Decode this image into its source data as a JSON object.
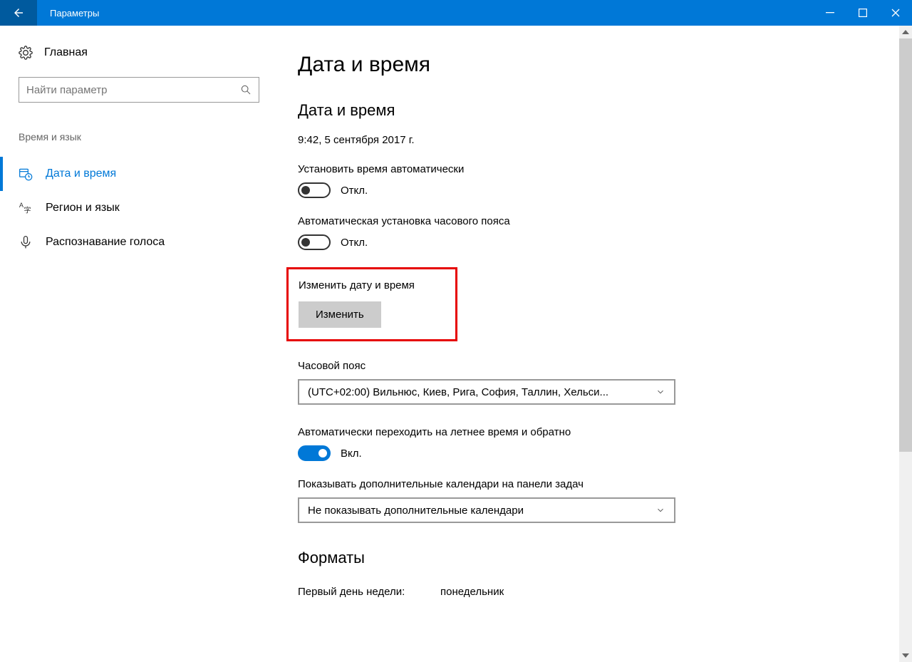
{
  "titlebar": {
    "title": "Параметры"
  },
  "sidebar": {
    "home": "Главная",
    "search_placeholder": "Найти параметр",
    "section": "Время и язык",
    "items": [
      {
        "label": "Дата и время"
      },
      {
        "label": "Регион и язык"
      },
      {
        "label": "Распознавание голоса"
      }
    ]
  },
  "page": {
    "title": "Дата и время",
    "datetime_section": "Дата и время",
    "current_datetime": "9:42, 5 сентября 2017 г.",
    "auto_time_label": "Установить время автоматически",
    "auto_time_state": "Откл.",
    "auto_tz_label": "Автоматическая установка часового пояса",
    "auto_tz_state": "Откл.",
    "change_dt_label": "Изменить дату и время",
    "change_button": "Изменить",
    "timezone_label": "Часовой пояс",
    "timezone_value": "(UTC+02:00) Вильнюс, Киев, Рига, София, Таллин, Хельси...",
    "dst_label": "Автоматически переходить на летнее время и обратно",
    "dst_state": "Вкл.",
    "calendars_label": "Показывать дополнительные календари на панели задач",
    "calendars_value": "Не показывать дополнительные календари",
    "formats_title": "Форматы",
    "first_day_label": "Первый день недели:",
    "first_day_value": "понедельник"
  }
}
